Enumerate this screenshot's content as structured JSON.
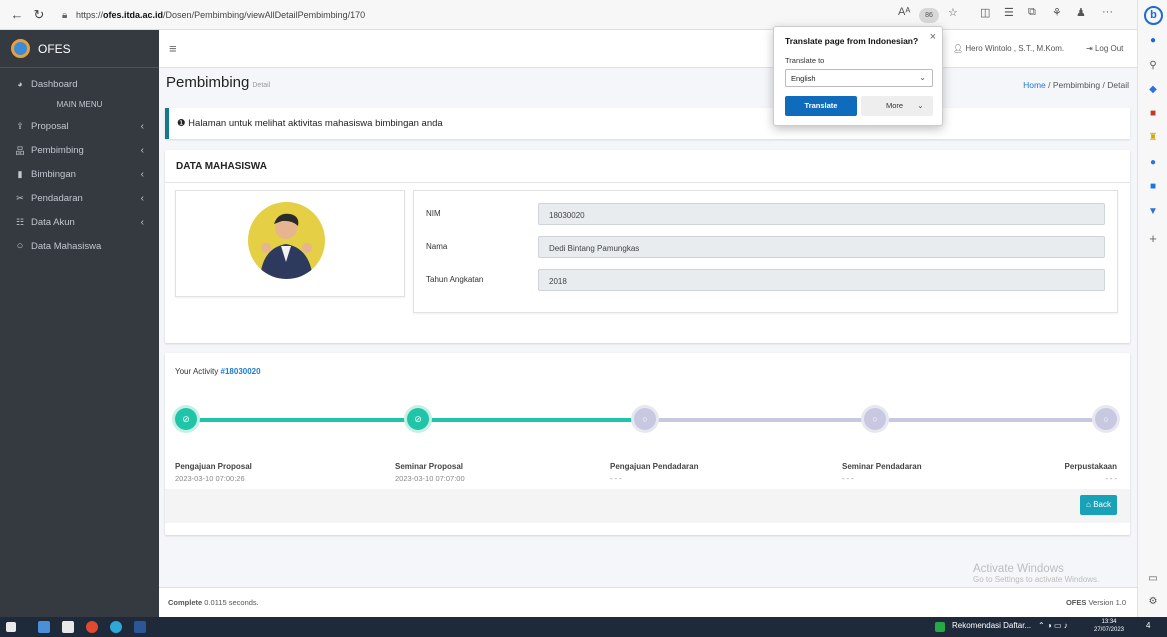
{
  "browser": {
    "url_prefix": "https://",
    "url_domain": "ofes.itda.ac.id",
    "url_path": "/Dosen/Pembimbing/viewAllDetailPembimbing/170",
    "profile_badge": "86",
    "more_label": "···"
  },
  "translate_popup": {
    "title": "Translate page from Indonesian?",
    "subtitle": "Translate to",
    "selected_language": "English",
    "translate_label": "Translate",
    "more_label": "More"
  },
  "sidebar": {
    "brand": "OFES",
    "dashboard": "Dashboard",
    "section": "MAIN MENU",
    "items": [
      {
        "label": "Proposal"
      },
      {
        "label": "Pembimbing"
      },
      {
        "label": "Bimbingan"
      },
      {
        "label": "Pendadaran"
      },
      {
        "label": "Data Akun"
      }
    ],
    "data_mahasiswa": "Data Mahasiswa"
  },
  "topnav": {
    "user": "Hero Wintolo , S.T., M.Kom.",
    "logout": "Log Out"
  },
  "page": {
    "title": "Pembimbing",
    "subtitle": "Detail",
    "breadcrumb": {
      "home": "Home",
      "sep1": "/",
      "section": "Pembimbing",
      "sep2": "/",
      "current": "Detail"
    },
    "callout": "Halaman untuk melihat aktivitas mahasiswa bimbingan anda"
  },
  "student": {
    "card_title": "DATA MAHASISWA",
    "nim_label": "NIM",
    "nim_value": "18030020",
    "nama_label": "Nama",
    "nama_value": "Dedi Bintang Pamungkas",
    "tahun_label": "Tahun Angkatan",
    "tahun_value": "2018"
  },
  "activity": {
    "title_prefix": "Your Activity",
    "title_id": "#18030020",
    "steps": [
      {
        "name": "Pengajuan Proposal",
        "date": "2023-03-10 07:00:26",
        "done": true
      },
      {
        "name": "Seminar Proposal",
        "date": "2023-03-10 07:07:00",
        "done": true
      },
      {
        "name": "Pengajuan Pendadaran",
        "date": "- - -",
        "done": false
      },
      {
        "name": "Seminar Pendadaran",
        "date": "- - -",
        "done": false
      },
      {
        "name": "Perpustakaan",
        "date": "- - -",
        "done": false
      }
    ],
    "back_label": "Back"
  },
  "footer": {
    "complete_label": "Complete",
    "complete_time": "0.0115 seconds.",
    "app_name": "OFES",
    "version": "Version 1.0"
  },
  "watermark": {
    "line1": "Activate Windows",
    "line2": "Go to Settings to activate Windows."
  },
  "taskbar": {
    "notification": "Rekomendasi Daftar...",
    "time": "13:34",
    "date": "27/07/2023",
    "badge": "4"
  },
  "colors": {
    "sidebar": "#343a40",
    "done_step": "#20c5a7",
    "todo_step": "#c8c9e0",
    "accent": "#17a2b8",
    "link": "#1e7ad1"
  }
}
